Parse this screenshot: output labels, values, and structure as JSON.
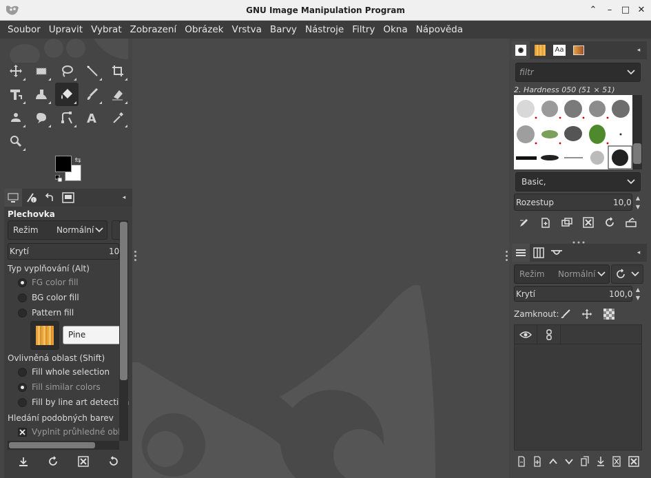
{
  "window": {
    "title": "GNU Image Manipulation Program"
  },
  "menu": [
    "Soubor",
    "Upravit",
    "Vybrat",
    "Zobrazení",
    "Obrázek",
    "Vrstva",
    "Barvy",
    "Nástroje",
    "Filtry",
    "Okna",
    "Nápověda"
  ],
  "tool_options": {
    "title": "Plechovka",
    "mode_label": "Režim",
    "mode_value": "Normální",
    "opacity_label": "Krytí",
    "opacity_value": "10",
    "fill_type_header": "Typ vyplňování  (Alt)",
    "fill_types": [
      "FG color fill",
      "BG color fill",
      "Pattern fill"
    ],
    "pattern_name": "Pine",
    "area_header": "Ovlivněná oblast  (Shift)",
    "areas": [
      "Fill whole selection",
      "Fill similar colors",
      "Fill by line art detection"
    ],
    "similar_header": "Hledání podobných barev",
    "transparent_label": "Vyplnit průhledné oblas"
  },
  "brushes": {
    "filter_placeholder": "filtr",
    "current_brush": "2. Hardness 050 (51 × 51)",
    "preset": "Basic,",
    "spacing_label": "Rozestup",
    "spacing_value": "10,0"
  },
  "layers": {
    "mode_label": "Režim",
    "mode_value": "Normální",
    "opacity_label": "Krytí",
    "opacity_value": "100,0",
    "lock_label": "Zamknout:"
  },
  "colors": {
    "foreground": "#000000",
    "background": "#ffffff",
    "accent": "#454545"
  }
}
